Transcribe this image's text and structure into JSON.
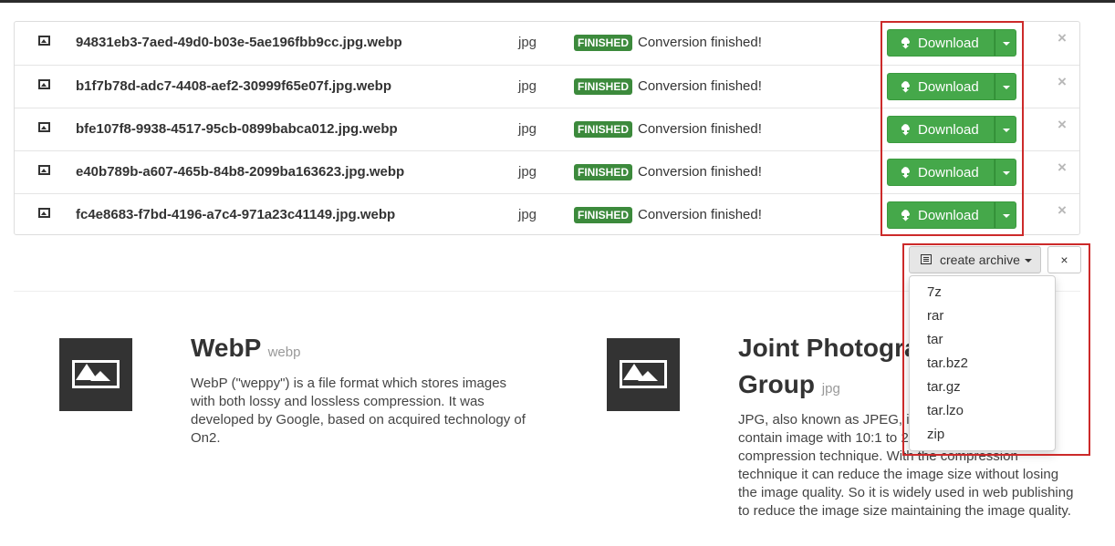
{
  "files": [
    {
      "name": "94831eb3-7aed-49d0-b03e-5ae196fbb9cc.jpg.webp",
      "ext": "jpg",
      "status": "FINISHED",
      "message": "Conversion finished!",
      "download": "Download"
    },
    {
      "name": "b1f7b78d-adc7-4408-aef2-30999f65e07f.jpg.webp",
      "ext": "jpg",
      "status": "FINISHED",
      "message": "Conversion finished!",
      "download": "Download"
    },
    {
      "name": "bfe107f8-9938-4517-95cb-0899babca012.jpg.webp",
      "ext": "jpg",
      "status": "FINISHED",
      "message": "Conversion finished!",
      "download": "Download"
    },
    {
      "name": "e40b789b-a607-465b-84b8-2099ba163623.jpg.webp",
      "ext": "jpg",
      "status": "FINISHED",
      "message": "Conversion finished!",
      "download": "Download"
    },
    {
      "name": "fc4e8683-f7bd-4196-a7c4-971a23c41149.jpg.webp",
      "ext": "jpg",
      "status": "FINISHED",
      "message": "Conversion finished!",
      "download": "Download"
    }
  ],
  "remove_glyph": "×",
  "archive": {
    "button_label": "create archive",
    "close_label": "×",
    "options": [
      "7z",
      "rar",
      "tar",
      "tar.bz2",
      "tar.gz",
      "tar.lzo",
      "zip"
    ]
  },
  "formats": [
    {
      "title_line1": "WebP",
      "title_line2": "",
      "short": "webp",
      "description_lines": [
        "WebP (\"weppy\") is a file format which stores images",
        "with both lossy and lossless compression. It was",
        "developed by Google, based on acquired technology of",
        "On2."
      ]
    },
    {
      "title_line1": "Joint Photograp",
      "title_line2": "Group",
      "short": "jpg",
      "description_lines": [
        "JPG, also known as JPEG, is a",
        "contain image with 10:1 to 2",
        "compression technique. With the compression",
        "technique it can reduce the image size without losing",
        "the image quality. So it is widely used in web publishing",
        "to reduce the image size maintaining the image quality."
      ]
    }
  ],
  "colors": {
    "download_green": "#45a84a",
    "finished_badge": "#3c8a3c",
    "highlight_red": "#cc2a2a"
  }
}
